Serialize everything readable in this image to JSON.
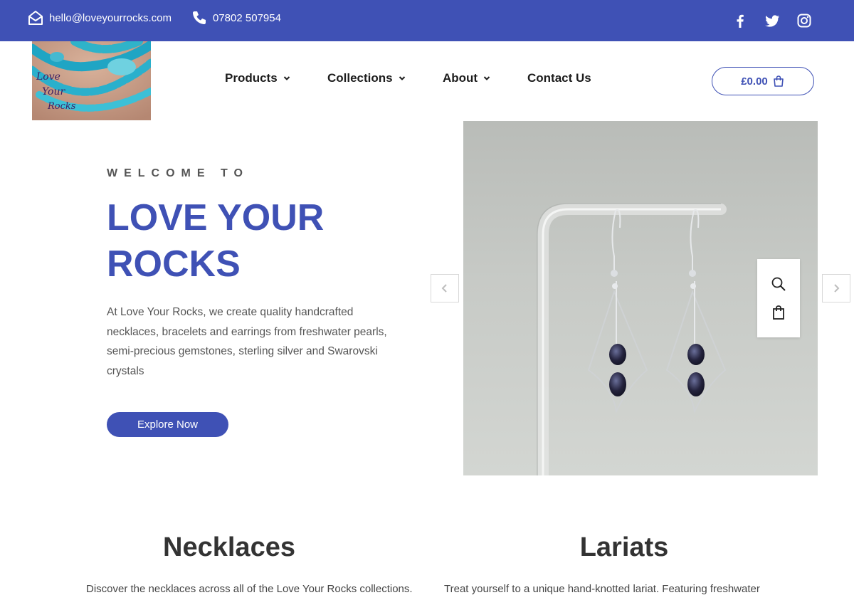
{
  "topbar": {
    "email": "hello@loveyourrocks.com",
    "phone": "07802 507954",
    "icons": [
      "envelope-open-icon",
      "phone-icon",
      "facebook-icon",
      "twitter-icon",
      "instagram-icon"
    ]
  },
  "header": {
    "logo_text": [
      "Love",
      "Your",
      "Rocks"
    ],
    "nav": [
      {
        "label": "Products",
        "dropdown": true
      },
      {
        "label": "Collections",
        "dropdown": true
      },
      {
        "label": "About",
        "dropdown": true
      },
      {
        "label": "Contact Us",
        "dropdown": false
      }
    ],
    "cart": {
      "total": "£0.00",
      "count": "0"
    }
  },
  "hero": {
    "eyebrow": "WELCOME TO",
    "title_line1": "LOVE YOUR",
    "title_line2": "ROCKS",
    "description": "At Love Your Rocks, we create quality handcrafted necklaces, bracelets and earrings from freshwater pearls, semi-precious gemstones, sterling silver and Swarovski crystals",
    "cta": "Explore Now"
  },
  "sections": [
    {
      "title": "Necklaces",
      "text": "Discover the necklaces across all of the Love Your Rocks collections."
    },
    {
      "title": "Lariats",
      "text": "Treat yourself to a unique hand-knotted lariat. Featuring freshwater"
    }
  ],
  "colors": {
    "accent": "#3f51b5",
    "text_dark": "#333333",
    "image_bg": "#c4c7c3"
  }
}
